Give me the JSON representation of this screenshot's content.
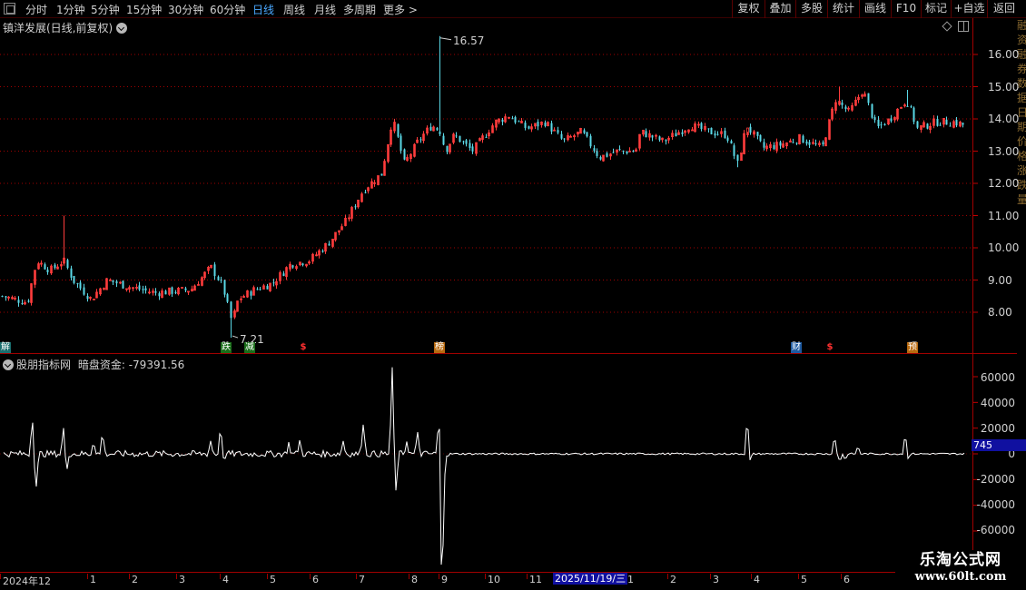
{
  "toolbar": {
    "periods": [
      "分时",
      "1分钟",
      "5分钟",
      "15分钟",
      "30分钟",
      "60分钟",
      "日线",
      "周线",
      "月线",
      "多周期",
      "更多 >"
    ],
    "active_period": "日线",
    "tools": [
      "复权",
      "叠加",
      "多股",
      "统计",
      "画线",
      "F10",
      "标记",
      "+自选",
      "返回"
    ]
  },
  "main": {
    "title": "镇洋发展(日线,前复权)",
    "price_ticks": [
      "16.00",
      "15.00",
      "14.00",
      "13.00",
      "12.00",
      "11.00",
      "10.00",
      "9.00",
      "8.00"
    ],
    "high_label": "16.57",
    "low_label": "7.21"
  },
  "events": [
    {
      "label": "解",
      "color": "teal"
    },
    {
      "label": "跌",
      "color": "green"
    },
    {
      "label": "减",
      "color": "green"
    },
    {
      "label": "$",
      "color": "red"
    },
    {
      "label": "榜",
      "color": "orange"
    },
    {
      "label": "财",
      "color": "blue"
    },
    {
      "label": "$",
      "color": "red"
    },
    {
      "label": "预",
      "color": "orange"
    }
  ],
  "indicator": {
    "title": "股朋指标网",
    "name": "暗盘资金:",
    "value": "-79391.56",
    "ticks": [
      "60000",
      "40000",
      "20000",
      "0",
      "-20000",
      "-40000",
      "-60000"
    ],
    "current_label": "745"
  },
  "date_axis": {
    "labels": [
      "2024年12",
      "1",
      "2",
      "3",
      "4",
      "5",
      "6",
      "7",
      "8",
      "9",
      "10",
      "11",
      "1",
      "2",
      "3",
      "4",
      "5",
      "6"
    ],
    "cursor_date": "2025/11/19/三"
  },
  "side_text": "融资融券数据日期价格涨跌量",
  "watermark": {
    "title": "乐淘公式网",
    "url": "www.60lt.com"
  },
  "colors": {
    "up": "#ff3c3c",
    "down": "#5ad8e6",
    "grid": "#a00000",
    "indicator_line": "#ffffff",
    "highlight": "#1010a0"
  },
  "chart_data": [
    {
      "type": "candlestick",
      "title": "镇洋发展(日线,前复权)",
      "ylim": [
        7.2,
        16.6
      ],
      "high": 16.57,
      "low": 7.21,
      "approx_close_path": [
        {
          "period": "2024-12",
          "close": 8.5
        },
        {
          "period": "2025-01",
          "close": 9.6
        },
        {
          "period": "2025-02",
          "close": 8.8
        },
        {
          "period": "2025-03",
          "close": 8.7
        },
        {
          "period": "2025-04",
          "close": 8.2
        },
        {
          "period": "2025-05",
          "close": 9.0
        },
        {
          "period": "2025-06",
          "close": 9.8
        },
        {
          "period": "2025-07",
          "close": 11.5
        },
        {
          "period": "2025-08",
          "close": 13.2
        },
        {
          "period": "2025-09",
          "close": 13.5
        },
        {
          "period": "2025-10",
          "close": 13.8
        },
        {
          "period": "2025-11",
          "close": 13.0
        },
        {
          "period": "2026-01",
          "close": 13.6
        },
        {
          "period": "2026-02",
          "close": 13.4
        },
        {
          "period": "2026-03",
          "close": 13.3
        },
        {
          "period": "2026-04",
          "close": 13.5
        },
        {
          "period": "2026-05",
          "close": 14.6
        },
        {
          "period": "2026-06",
          "close": 13.8
        }
      ]
    },
    {
      "type": "line",
      "name": "暗盘资金",
      "ylim": [
        -70000,
        70000
      ],
      "last_value": -79391.56
    }
  ]
}
